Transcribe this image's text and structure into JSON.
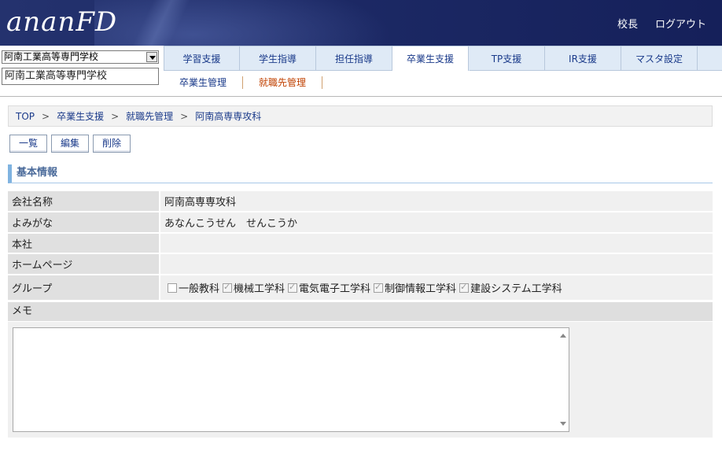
{
  "header": {
    "logo": "ananFD",
    "user_label": "校長",
    "logout_label": "ログアウト"
  },
  "school_selector": {
    "selected": "阿南工業高等専門学校",
    "display": "阿南工業高等専門学校"
  },
  "tabs": [
    {
      "label": "学習支援",
      "active": false
    },
    {
      "label": "学生指導",
      "active": false
    },
    {
      "label": "担任指導",
      "active": false
    },
    {
      "label": "卒業生支援",
      "active": true
    },
    {
      "label": "TP支援",
      "active": false
    },
    {
      "label": "IR支援",
      "active": false
    },
    {
      "label": "マスタ設定",
      "active": false
    }
  ],
  "sub_tabs": [
    {
      "label": "卒業生管理",
      "active": false
    },
    {
      "label": "就職先管理",
      "active": true
    }
  ],
  "breadcrumb": [
    "TOP",
    "卒業生支援",
    "就職先管理",
    "阿南高専専攻科"
  ],
  "breadcrumb_sep": ">",
  "actions": {
    "list": "一覧",
    "edit": "編集",
    "delete": "削除"
  },
  "section_title": "基本情報",
  "fields": {
    "company_name": {
      "label": "会社名称",
      "value": "阿南高専専攻科"
    },
    "reading": {
      "label": "よみがな",
      "value": "あなんこうせん　せんこうか"
    },
    "head_office": {
      "label": "本社",
      "value": ""
    },
    "homepage": {
      "label": "ホームページ",
      "value": ""
    },
    "group": {
      "label": "グループ",
      "options": [
        {
          "label": "一般教科",
          "checked": false
        },
        {
          "label": "機械工学科",
          "checked": true
        },
        {
          "label": "電気電子工学科",
          "checked": true
        },
        {
          "label": "制御情報工学科",
          "checked": true
        },
        {
          "label": "建設システム工学科",
          "checked": true
        }
      ]
    },
    "memo": {
      "label": "メモ",
      "value": ""
    }
  }
}
